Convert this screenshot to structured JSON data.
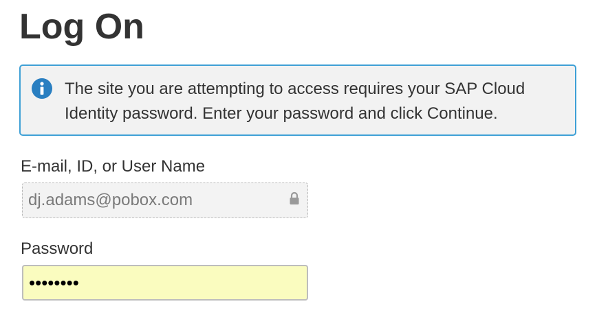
{
  "page": {
    "title": "Log On"
  },
  "info": {
    "icon": "info-icon",
    "message": "The site you are attempting to access requires your SAP Cloud Identity password. Enter your password and click Continue."
  },
  "fields": {
    "user": {
      "label": "E-mail, ID, or User Name",
      "value": "dj.adams@pobox.com",
      "icon": "lock-icon",
      "readonly": true
    },
    "password": {
      "label": "Password",
      "value": "••••••••"
    }
  },
  "colors": {
    "info_border": "#3ea0d6",
    "info_icon": "#2a7fc1",
    "autofill_background": "#fafcbf"
  }
}
